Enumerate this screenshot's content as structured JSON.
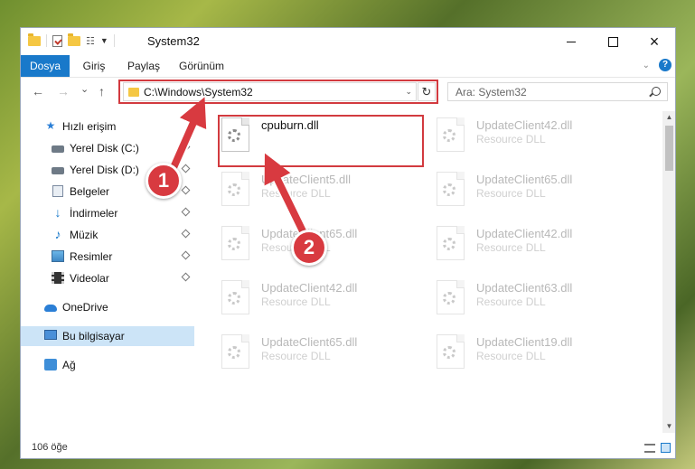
{
  "window": {
    "title": "System32",
    "controls": {
      "minimize": "minimize-icon",
      "maximize": "maximize-icon",
      "close": "×"
    }
  },
  "ribbon": {
    "tabs": [
      "Dosya",
      "Giriş",
      "Paylaş",
      "Görünüm"
    ],
    "active_tab": "Dosya",
    "help": "?",
    "colors": {
      "accent": "#1979ca"
    }
  },
  "navigation": {
    "back": "←",
    "forward": "→",
    "recent": "⌄",
    "up": "↑",
    "address": "C:\\Windows\\System32",
    "refresh": "↻",
    "search_placeholder": "Ara: System32"
  },
  "sidebar": {
    "items": [
      {
        "label": "Hızlı erişim",
        "icon": "star-icon"
      },
      {
        "label": "Yerel Disk (C:)",
        "icon": "disk-icon",
        "pinned": true
      },
      {
        "label": "Yerel Disk (D:)",
        "icon": "disk-icon",
        "pinned": true
      },
      {
        "label": "Belgeler",
        "icon": "document-icon",
        "pinned": true
      },
      {
        "label": "İndirmeler",
        "icon": "download-icon",
        "pinned": true
      },
      {
        "label": "Müzik",
        "icon": "music-icon",
        "pinned": true
      },
      {
        "label": "Resimler",
        "icon": "pictures-icon",
        "pinned": true
      },
      {
        "label": "Videolar",
        "icon": "video-icon",
        "pinned": true
      },
      {
        "label": "OneDrive",
        "icon": "cloud-icon"
      },
      {
        "label": "Bu bilgisayar",
        "icon": "computer-icon",
        "selected": true
      },
      {
        "label": "Ağ",
        "icon": "network-icon"
      }
    ]
  },
  "files": [
    {
      "name": "cpuburn.dll",
      "type": ""
    },
    {
      "name": "UpdateClient42.dll",
      "type": "Resource DLL"
    },
    {
      "name": "UpdateClient5.dll",
      "type": "Resource DLL"
    },
    {
      "name": "UpdateClient65.dll",
      "type": "Resource DLL"
    },
    {
      "name": "UpdateClient65.dll",
      "type": "Resource DLL"
    },
    {
      "name": "UpdateClient42.dll",
      "type": "Resource DLL"
    },
    {
      "name": "UpdateClient42.dll",
      "type": "Resource DLL"
    },
    {
      "name": "UpdateClient63.dll",
      "type": "Resource DLL"
    },
    {
      "name": "UpdateClient65.dll",
      "type": "Resource DLL"
    },
    {
      "name": "UpdateClient19.dll",
      "type": "Resource DLL"
    }
  ],
  "status": {
    "item_count": "106 öğe"
  },
  "annotations": {
    "steps": [
      "1",
      "2"
    ],
    "color": "#d83a40"
  }
}
